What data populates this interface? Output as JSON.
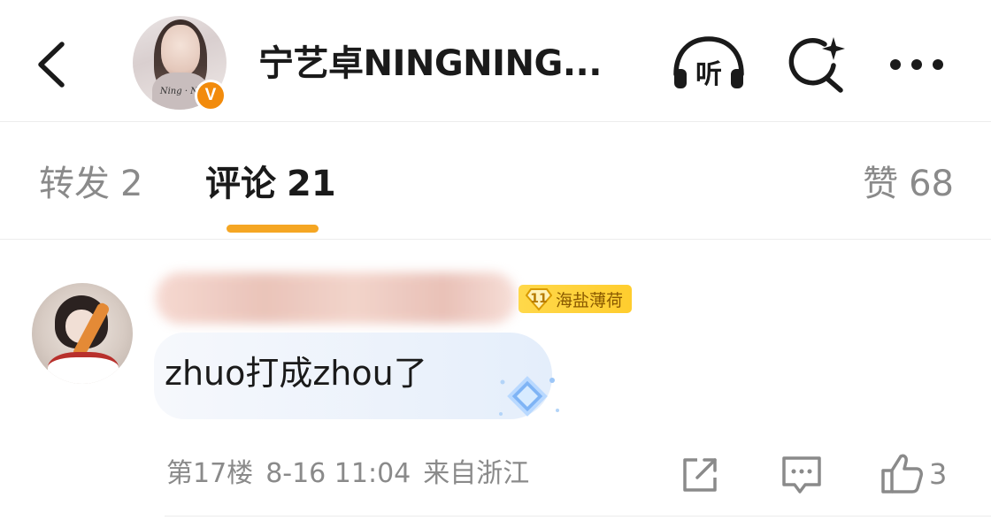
{
  "header": {
    "title": "宁艺卓NINGNING...",
    "avatar_signature": "Ning · Ni",
    "verified_badge": "V",
    "icons": {
      "back": "chevron-left-icon",
      "listen": "headphones-icon",
      "listen_label": "听",
      "search": "search-sparkle-icon",
      "more": "more-dots-icon"
    }
  },
  "tabs": {
    "repost": {
      "label": "转发",
      "count": "2"
    },
    "comment": {
      "label": "评论",
      "count": "21"
    },
    "like": {
      "label": "赞",
      "count": "68"
    },
    "active": "comment",
    "accent": "#f5a623"
  },
  "comment": {
    "username_hidden": true,
    "rank_badge": {
      "level": "11",
      "name": "海盐薄荷"
    },
    "text": "zhuo打成zhou了",
    "meta": {
      "floor": "第17楼",
      "time": "8-16 11:04",
      "location": "来自浙江"
    },
    "actions": {
      "share": "share-icon",
      "reply": "reply-icon",
      "like": "thumb-up-icon",
      "like_count": "3"
    }
  },
  "colors": {
    "accent": "#f5a623",
    "verified": "#f28b0c",
    "muted": "#8a8a8a",
    "badge": "#ffcd2e"
  }
}
